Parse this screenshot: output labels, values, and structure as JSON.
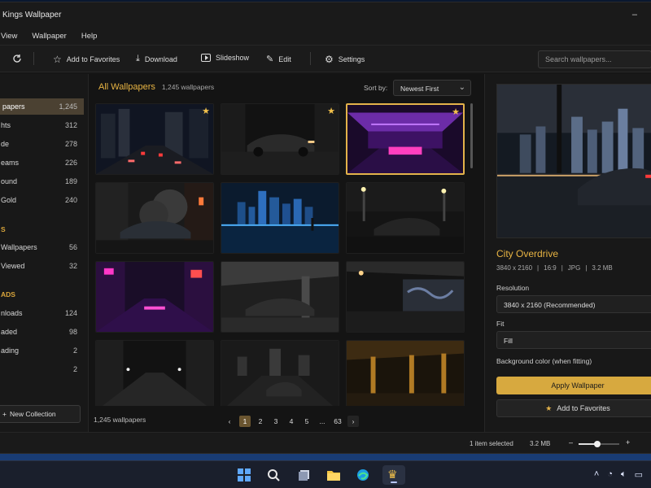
{
  "window": {
    "title": "Kings Wallpaper",
    "minimize_glyph": "–"
  },
  "menu": [
    "View",
    "Wallpaper",
    "Help"
  ],
  "toolbar": {
    "add_to_favorites": "Add to Favorites",
    "download": "Download",
    "slideshow": "Slideshow",
    "edit": "Edit",
    "settings": "Settings",
    "search_placeholder": "Search wallpapers..."
  },
  "sidebar": {
    "items": [
      {
        "label": "papers",
        "count": "1,245",
        "active": true
      },
      {
        "label": "hts",
        "count": "312"
      },
      {
        "label": "de",
        "count": "278"
      },
      {
        "label": "eams",
        "count": "226"
      },
      {
        "label": "ound",
        "count": "189"
      },
      {
        "label": "Gold",
        "count": "240"
      }
    ],
    "section2": "S",
    "items2": [
      {
        "label": "Wallpapers",
        "count": "56"
      },
      {
        "label": "Viewed",
        "count": "32"
      }
    ],
    "section3": "ADS",
    "items3": [
      {
        "label": "nloads",
        "count": "124"
      },
      {
        "label": "aded",
        "count": "98"
      },
      {
        "label": "ading",
        "count": "2"
      },
      {
        "label": "",
        "count": "2"
      }
    ],
    "new_collection": "New Collection"
  },
  "main": {
    "title": "All Wallpapers",
    "count": "1,245 wallpapers",
    "sort_label": "Sort by:",
    "sort_value": "Newest First",
    "footer_count": "1,245 wallpapers",
    "pages": [
      "1",
      "2",
      "3",
      "4",
      "5",
      "...",
      "63"
    ],
    "thumbnails": [
      {
        "name": "city-street-night",
        "favorite": true,
        "selected": false
      },
      {
        "name": "dark-car-alley",
        "favorite": true,
        "selected": false
      },
      {
        "name": "purple-tunnel",
        "favorite": true,
        "selected": true
      },
      {
        "name": "smoke-car",
        "favorite": false,
        "selected": false
      },
      {
        "name": "blue-skyline",
        "favorite": false,
        "selected": false
      },
      {
        "name": "night-car-lot",
        "favorite": false,
        "selected": false
      },
      {
        "name": "neon-street",
        "favorite": false,
        "selected": false
      },
      {
        "name": "bridge-car",
        "favorite": false,
        "selected": false
      },
      {
        "name": "graffiti-bridge",
        "favorite": false,
        "selected": false
      },
      {
        "name": "wet-avenue",
        "favorite": false,
        "selected": false
      },
      {
        "name": "city-road-car",
        "favorite": false,
        "selected": false
      },
      {
        "name": "golden-bridge",
        "favorite": false,
        "selected": false
      }
    ]
  },
  "details": {
    "title": "City Overdrive",
    "resolution_text": "3840 x 2160",
    "aspect": "16:9",
    "format": "JPG",
    "filesize": "3.2 MB",
    "resolution_label": "Resolution",
    "resolution_value": "3840 x 2160  (Recommended)",
    "fit_label": "Fit",
    "fit_value": "Fill",
    "bg_label": "Background color (when fitting)",
    "apply": "Apply Wallpaper",
    "favorite": "Add to Favorites"
  },
  "status": {
    "selected": "1 item selected",
    "size": "3.2 MB",
    "zoom_level": 0.45
  },
  "colors": {
    "accent": "#e0b34a",
    "window_bg": "#161616"
  }
}
